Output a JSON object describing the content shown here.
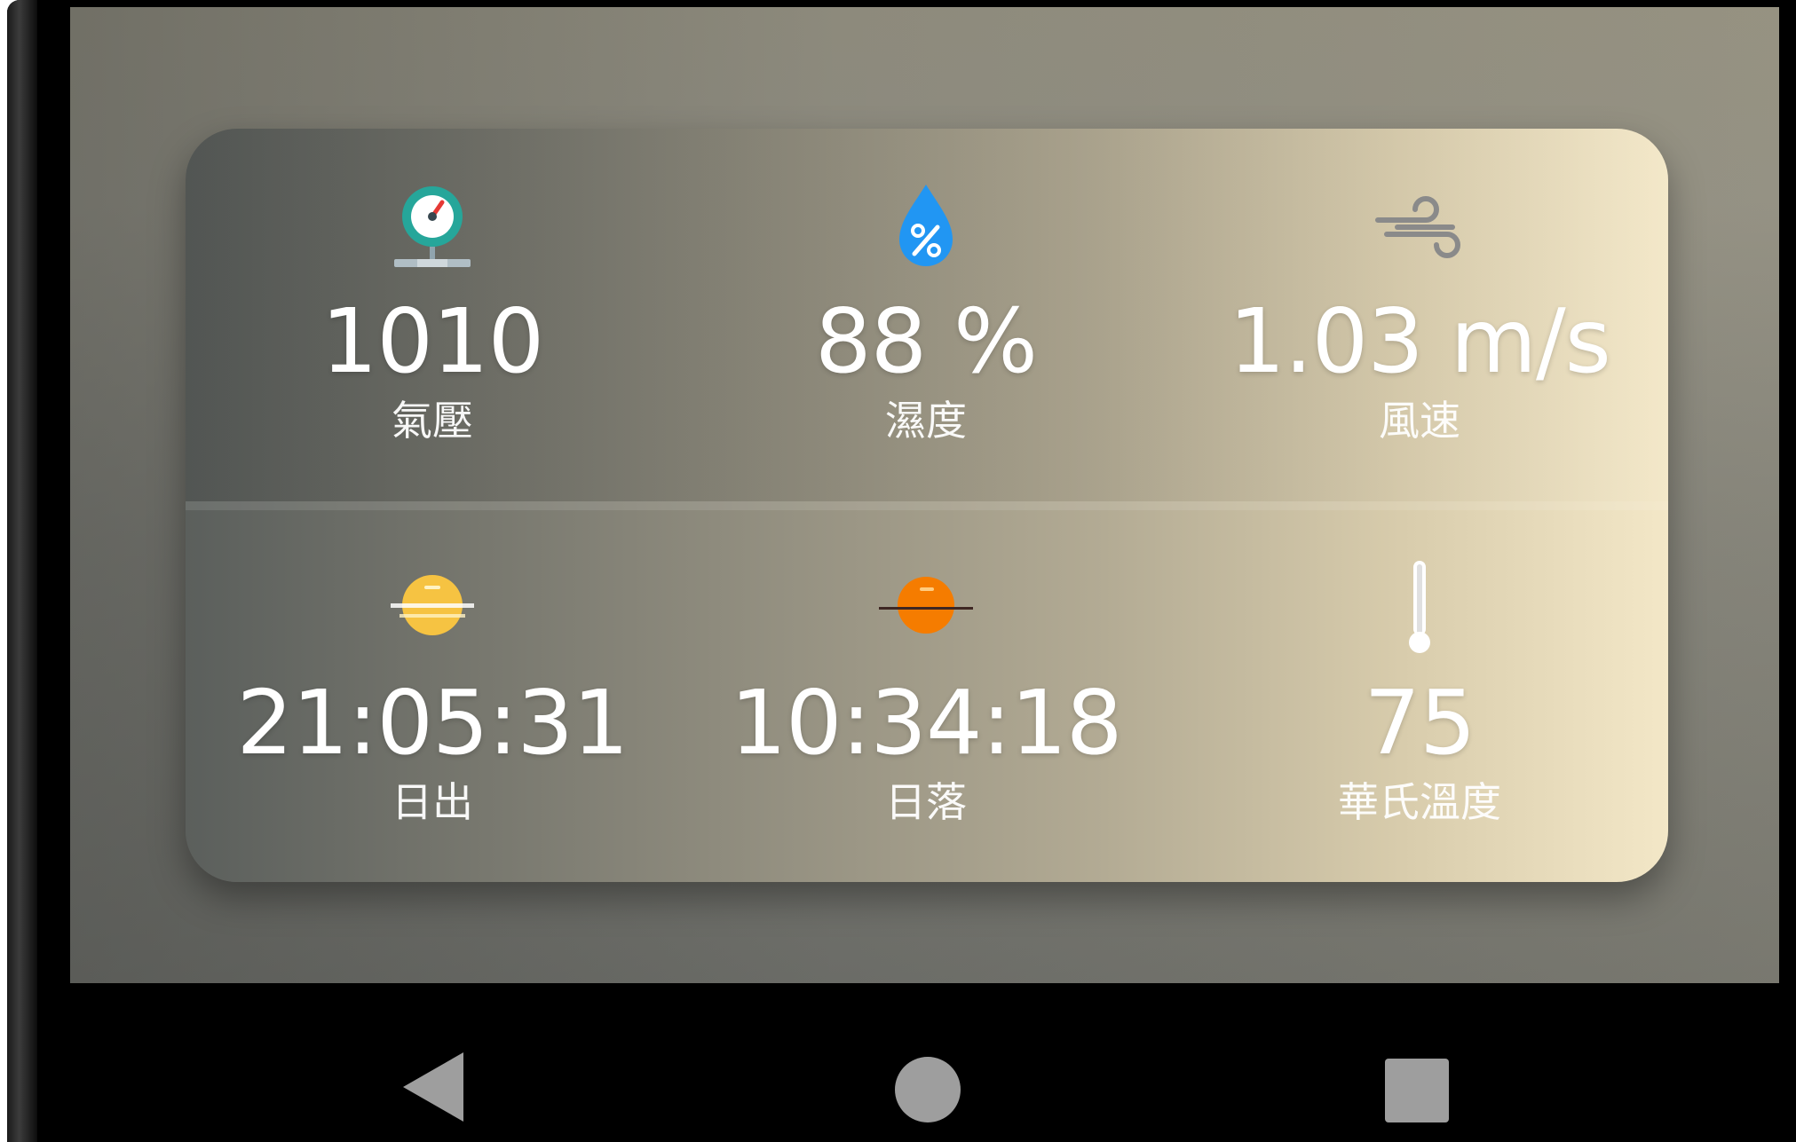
{
  "colors": {
    "pressure_ring": "#26a69a",
    "pressure_needle": "#e53935",
    "humidity_drop": "#2196f3",
    "wind": "#8a8a8a",
    "sunrise": "#f6c342",
    "sunset": "#f57c00",
    "thermometer": "#ffffff",
    "nav_gray": "#9e9e9e"
  },
  "weather": {
    "pressure": {
      "value": "1010",
      "label": "氣壓",
      "icon": "pressure-gauge-icon"
    },
    "humidity": {
      "value": "88 %",
      "label": "濕度",
      "icon": "humidity-drop-icon"
    },
    "wind": {
      "value": "1.03 m/s",
      "label": "風速",
      "icon": "wind-icon"
    },
    "sunrise": {
      "value": "21:05:31",
      "label": "日出",
      "icon": "sunrise-icon"
    },
    "sunset": {
      "value": "10:34:18",
      "label": "日落",
      "icon": "sunset-icon"
    },
    "fahrenheit": {
      "value": "75",
      "label": "華氏溫度",
      "icon": "thermometer-icon"
    }
  },
  "navbar": {
    "back": "back-icon",
    "home": "home-icon",
    "recents": "recents-icon"
  }
}
